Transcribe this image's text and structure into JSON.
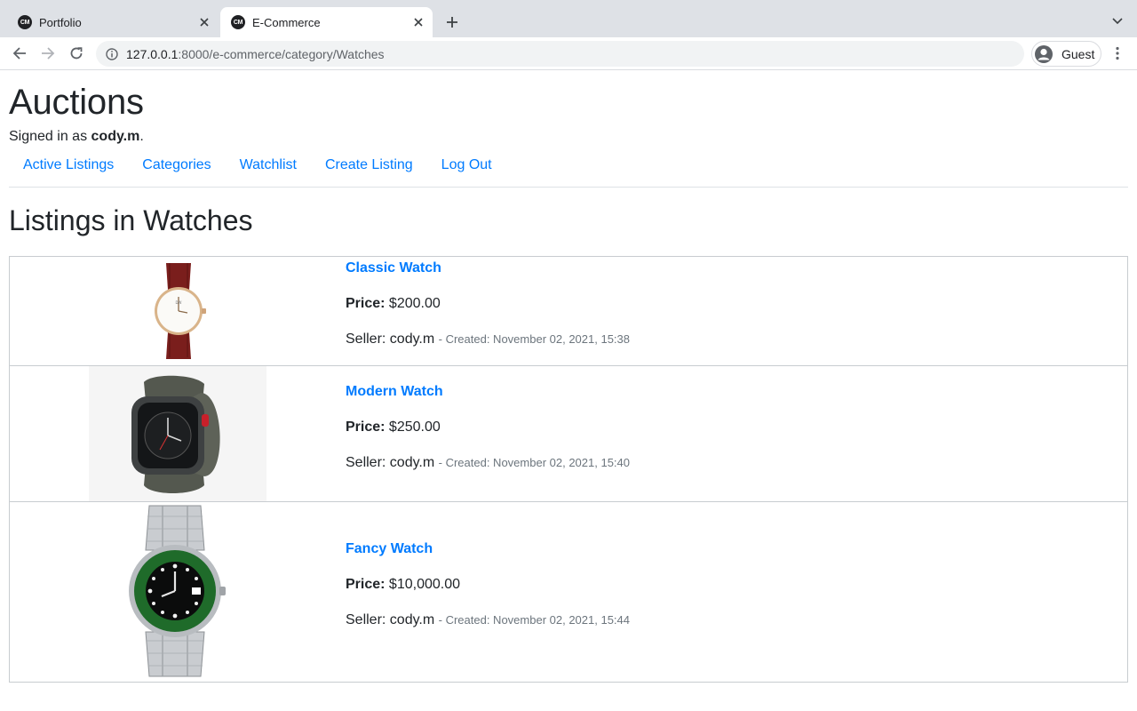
{
  "browser": {
    "tabs": [
      {
        "favicon": "CM",
        "title": "Portfolio",
        "active": false
      },
      {
        "favicon": "CM",
        "title": "E-Commerce",
        "active": true
      }
    ],
    "url_host": "127.0.0.1",
    "url_path": ":8000/e-commerce/category/Watches",
    "profile_label": "Guest"
  },
  "site": {
    "title": "Auctions",
    "signed_in_prefix": "Signed in as ",
    "username": "cody.m",
    "signed_in_suffix": ".",
    "nav": [
      "Active Listings",
      "Categories",
      "Watchlist",
      "Create Listing",
      "Log Out"
    ]
  },
  "page": {
    "heading": "Listings in Watches",
    "price_label": "Price:",
    "seller_prefix": "Seller: ",
    "listings": [
      {
        "title": "Classic Watch",
        "price": "$200.00",
        "seller": "cody.m",
        "created": "- Created: November 02, 2021, 15:38",
        "image": "classic-watch-image"
      },
      {
        "title": "Modern Watch",
        "price": "$250.00",
        "seller": "cody.m",
        "created": "- Created: November 02, 2021, 15:40",
        "image": "smart-watch-image"
      },
      {
        "title": "Fancy Watch",
        "price": "$10,000.00",
        "seller": "cody.m",
        "created": "- Created: November 02, 2021, 15:44",
        "image": "luxury-watch-image"
      }
    ]
  },
  "colors": {
    "link": "#007bff",
    "tabstrip": "#dee1e6",
    "text": "#212529",
    "muted": "#6c757d"
  }
}
